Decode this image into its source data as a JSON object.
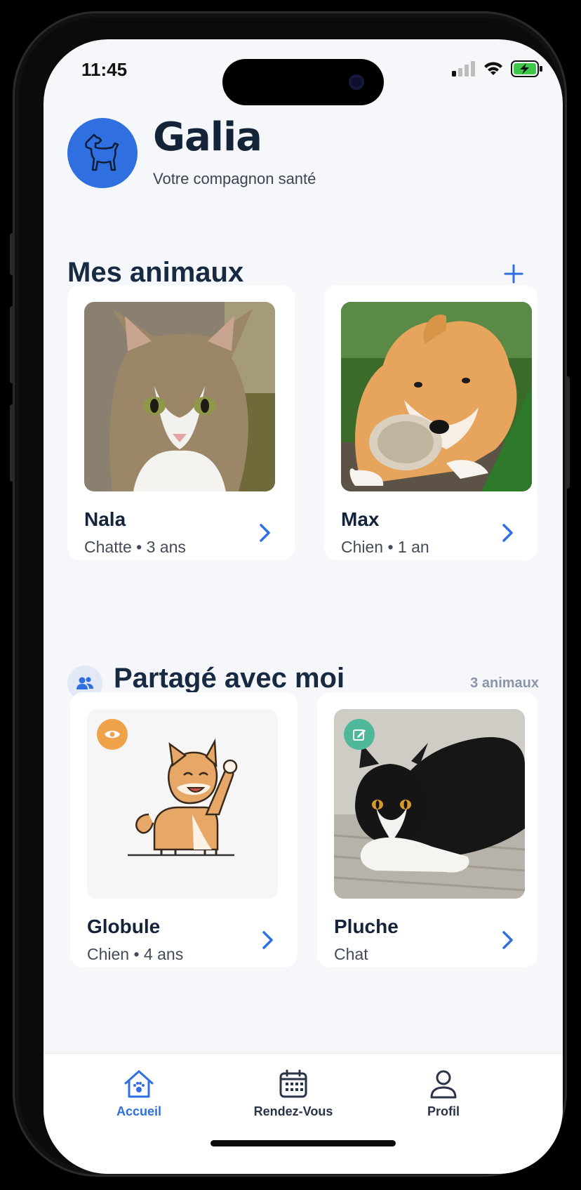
{
  "status": {
    "time": "11:45"
  },
  "brand": {
    "title": "Galia",
    "subtitle": "Votre compagnon santé"
  },
  "my_pets": {
    "title": "Mes animaux",
    "add_icon": "plus-icon",
    "items": [
      {
        "name": "Nala",
        "meta": "Chatte • 3 ans",
        "photo": "tabby-cat"
      },
      {
        "name": "Max",
        "meta": "Chien • 1 an",
        "photo": "akita-puppy"
      }
    ]
  },
  "shared": {
    "title": "Partagé avec moi",
    "count": "3 animaux",
    "items": [
      {
        "name": "Globule",
        "meta": "Chien • 4 ans",
        "photo": "shiba-illustration",
        "badge": "eye-icon",
        "badge_color": "#f0a24a"
      },
      {
        "name": "Pluche",
        "meta": "Chat",
        "photo": "black-white-cat",
        "badge": "edit-icon",
        "badge_color": "#4fb79a"
      }
    ]
  },
  "tabs": [
    {
      "label": "Accueil",
      "icon": "home-paw-icon",
      "active": true
    },
    {
      "label": "Rendez-Vous",
      "icon": "calendar-icon",
      "active": false
    },
    {
      "label": "Profil",
      "icon": "person-icon",
      "active": false
    }
  ],
  "colors": {
    "accent": "#2f6fe0",
    "title": "#182a41",
    "background": "#f6f7fb"
  }
}
